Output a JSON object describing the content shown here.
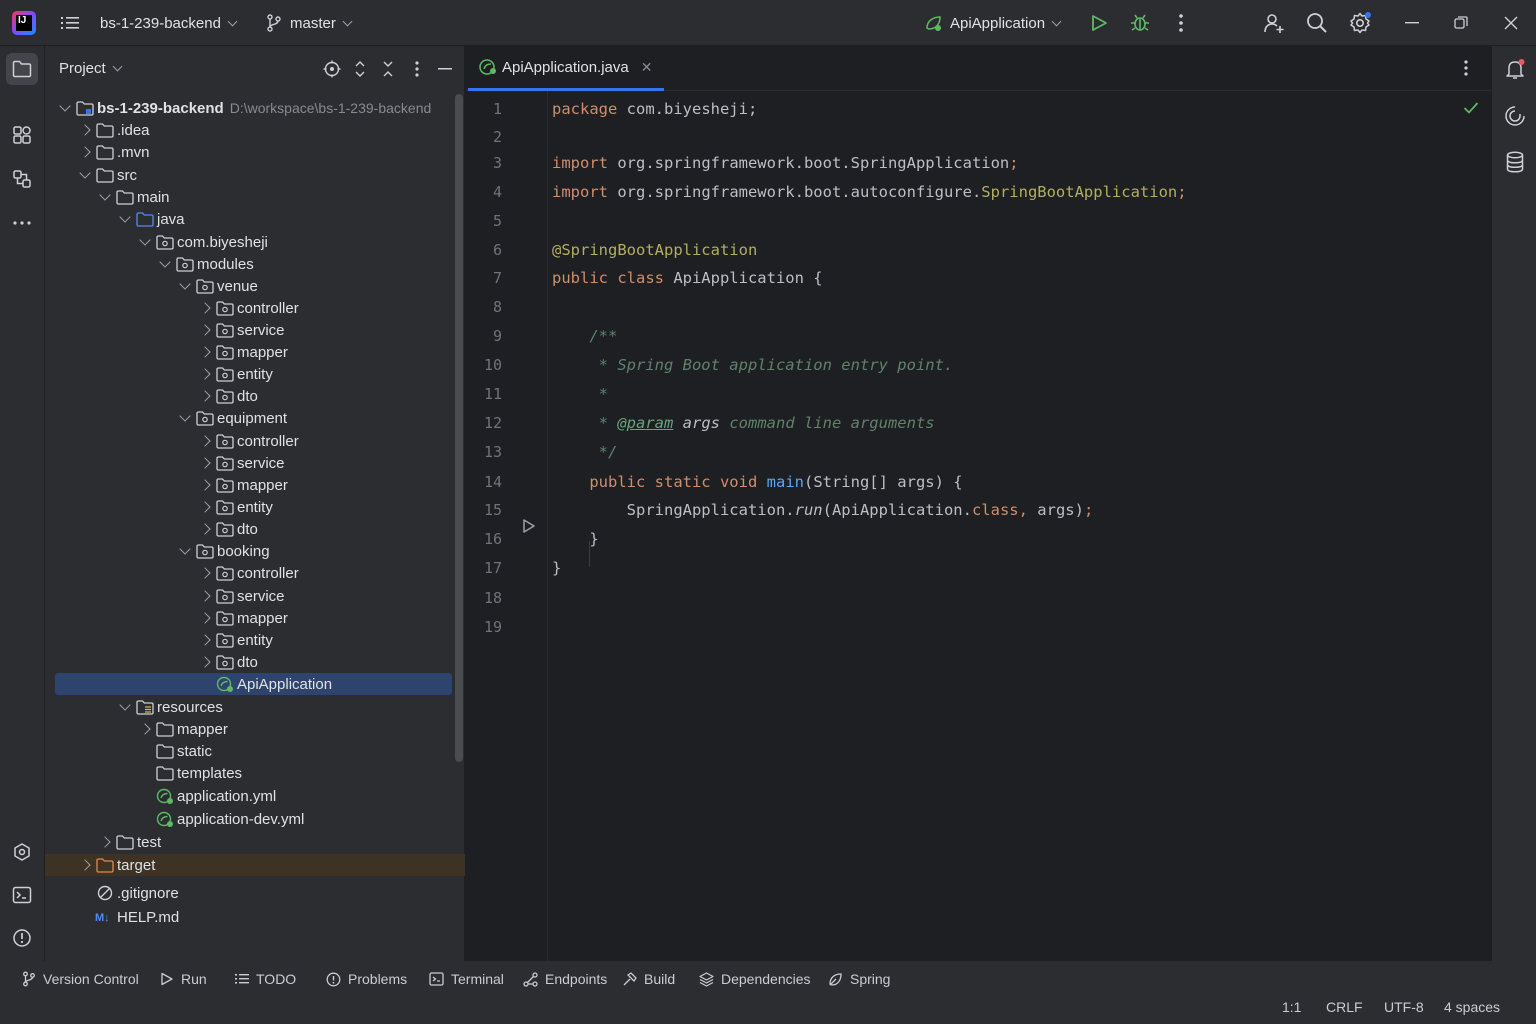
{
  "titlebar": {
    "project_name": "bs-1-239-backend",
    "branch": "master",
    "run_config": "ApiApplication"
  },
  "project_panel": {
    "title": "Project",
    "tree": [
      {
        "label": "bs-1-239-backend",
        "path": "D:\\workspace\\bs-1-239-backend",
        "depth": 0,
        "expanded": true,
        "icon": "module-folder-icon",
        "bold": true
      },
      {
        "label": ".idea",
        "depth": 1,
        "expanded": false,
        "icon": "folder-icon"
      },
      {
        "label": ".mvn",
        "depth": 1,
        "expanded": false,
        "icon": "folder-icon"
      },
      {
        "label": "src",
        "depth": 1,
        "expanded": true,
        "icon": "folder-icon"
      },
      {
        "label": "main",
        "depth": 2,
        "expanded": true,
        "icon": "folder-icon"
      },
      {
        "label": "java",
        "depth": 3,
        "expanded": true,
        "icon": "source-folder-icon"
      },
      {
        "label": "com.biyesheji",
        "depth": 4,
        "expanded": true,
        "icon": "package-icon"
      },
      {
        "label": "modules",
        "depth": 5,
        "expanded": true,
        "icon": "package-icon"
      },
      {
        "label": "venue",
        "depth": 6,
        "expanded": true,
        "icon": "package-icon"
      },
      {
        "label": "controller",
        "depth": 7,
        "expanded": false,
        "icon": "package-icon"
      },
      {
        "label": "service",
        "depth": 7,
        "expanded": false,
        "icon": "package-icon"
      },
      {
        "label": "mapper",
        "depth": 7,
        "expanded": false,
        "icon": "package-icon"
      },
      {
        "label": "entity",
        "depth": 7,
        "expanded": false,
        "icon": "package-icon"
      },
      {
        "label": "dto",
        "depth": 7,
        "expanded": false,
        "icon": "package-icon"
      },
      {
        "label": "equipment",
        "depth": 6,
        "expanded": true,
        "icon": "package-icon"
      },
      {
        "label": "controller",
        "depth": 7,
        "expanded": false,
        "icon": "package-icon"
      },
      {
        "label": "service",
        "depth": 7,
        "expanded": false,
        "icon": "package-icon"
      },
      {
        "label": "mapper",
        "depth": 7,
        "expanded": false,
        "icon": "package-icon"
      },
      {
        "label": "entity",
        "depth": 7,
        "expanded": false,
        "icon": "package-icon"
      },
      {
        "label": "dto",
        "depth": 7,
        "expanded": false,
        "icon": "package-icon"
      },
      {
        "label": "booking",
        "depth": 6,
        "expanded": true,
        "icon": "package-icon"
      },
      {
        "label": "controller",
        "depth": 7,
        "expanded": false,
        "icon": "package-icon"
      },
      {
        "label": "service",
        "depth": 7,
        "expanded": false,
        "icon": "package-icon"
      },
      {
        "label": "mapper",
        "depth": 7,
        "expanded": false,
        "icon": "package-icon"
      },
      {
        "label": "entity",
        "depth": 7,
        "expanded": false,
        "icon": "package-icon"
      },
      {
        "label": "dto",
        "depth": 7,
        "expanded": false,
        "icon": "package-icon"
      },
      {
        "label": "ApiApplication",
        "depth": 7,
        "leaf": true,
        "icon": "spring-class-icon",
        "selected": true
      },
      {
        "label": "resources",
        "depth": 3,
        "expanded": true,
        "icon": "resources-folder-icon"
      },
      {
        "label": "mapper",
        "depth": 4,
        "expanded": false,
        "icon": "folder-icon"
      },
      {
        "label": "static",
        "depth": 4,
        "leaf": true,
        "icon": "folder-icon"
      },
      {
        "label": "templates",
        "depth": 4,
        "leaf": true,
        "icon": "folder-icon"
      },
      {
        "label": "application.yml",
        "depth": 4,
        "leaf": true,
        "icon": "spring-config-icon"
      },
      {
        "label": "application-dev.yml",
        "depth": 4,
        "leaf": true,
        "icon": "spring-config-icon"
      },
      {
        "label": "test",
        "depth": 2,
        "expanded": false,
        "icon": "folder-icon"
      },
      {
        "label": "target",
        "depth": 1,
        "expanded": false,
        "icon": "excluded-folder-icon",
        "highlight": true
      },
      {
        "label": ".gitignore",
        "depth": 1,
        "leaf": true,
        "icon": "gitignore-icon"
      },
      {
        "label": "HELP.md",
        "depth": 1,
        "leaf": true,
        "icon": "markdown-icon"
      }
    ]
  },
  "editor": {
    "tab_label": "ApiApplication.java",
    "line_numbers": [
      "1",
      "2",
      "3",
      "4",
      "5",
      "6",
      "7",
      "8",
      "9",
      "10",
      "11",
      "12",
      "13",
      "14",
      "15",
      "16",
      "17",
      "18",
      "19"
    ]
  },
  "bottom_toolbar": [
    {
      "label": "Version Control",
      "icon": "git-branch-icon"
    },
    {
      "label": "Run",
      "icon": "run-icon"
    },
    {
      "label": "TODO",
      "icon": "todo-list-icon"
    },
    {
      "label": "Problems",
      "icon": "problems-icon"
    },
    {
      "label": "Terminal",
      "icon": "terminal-icon"
    },
    {
      "label": "Endpoints",
      "icon": "endpoints-icon"
    },
    {
      "label": "Build",
      "icon": "build-hammer-icon"
    },
    {
      "label": "Dependencies",
      "icon": "dependencies-icon"
    },
    {
      "label": "Spring",
      "icon": "spring-leaf-icon"
    }
  ],
  "statusbar": {
    "position": "1:1",
    "line_ending": "CRLF",
    "encoding": "UTF-8",
    "indent": "4 spaces"
  },
  "colors": {
    "accent": "#3574f0",
    "selection": "#2e436e",
    "keyword": "#cf8e6d",
    "annotation": "#b3ae60",
    "comment": "#5f826b",
    "function": "#56a8f5",
    "run_green": "#5fb865"
  }
}
